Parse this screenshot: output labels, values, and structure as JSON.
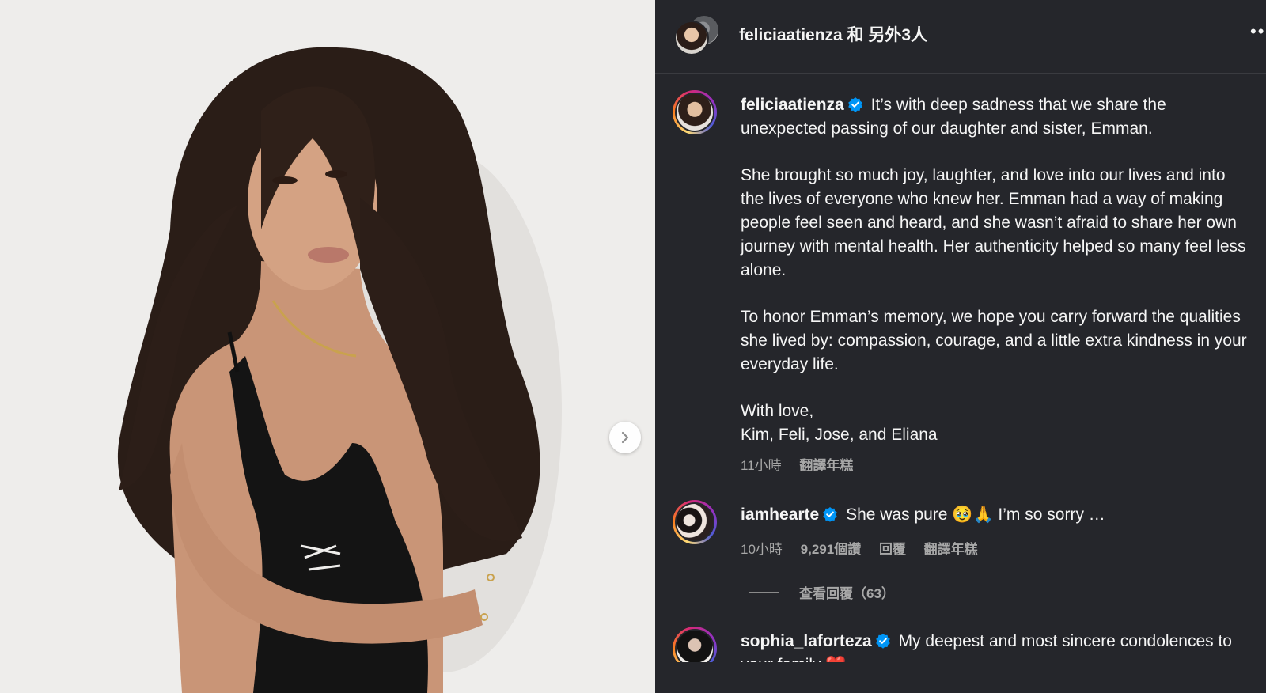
{
  "post": {
    "header_title": "feliciaatienza 和 另外3人",
    "more_icon": "more-horizontal-icon"
  },
  "caption": {
    "username": "feliciaatienza",
    "verified": true,
    "paragraphs": [
      "It’s with deep sadness that we share the unexpected passing of our daughter and sister, Emman.",
      "She brought so much joy, laughter, and love into our lives and into the lives of everyone who knew her. Emman had a way of making people feel seen and heard, and she wasn’t afraid to share her own journey with mental health. Her authenticity helped so many feel less alone.",
      "To honor Emman’s memory, we hope you carry forward the qualities she lived by: compassion, courage, and a little extra kindness in your everyday life."
    ],
    "signoff_1": "With love,",
    "signoff_2": "Kim, Feli, Jose, and Eliana",
    "time": "11小時",
    "translate": "翻譯年糕"
  },
  "comments": [
    {
      "username": "iamhearte",
      "verified": true,
      "text": "She was pure 🥹🙏 I’m so sorry …",
      "time": "10小時",
      "likes": "9,291個讚",
      "reply": "回覆",
      "translate": "翻譯年糕",
      "view_replies": "查看回覆（63）"
    },
    {
      "username": "sophia_laforteza",
      "verified": true,
      "text": "My deepest and most sincere condolences to your family ❤️"
    }
  ],
  "colors": {
    "panel_bg": "#25262b",
    "verified_blue": "#0095f6",
    "muted_text": "#a8a8a8"
  }
}
